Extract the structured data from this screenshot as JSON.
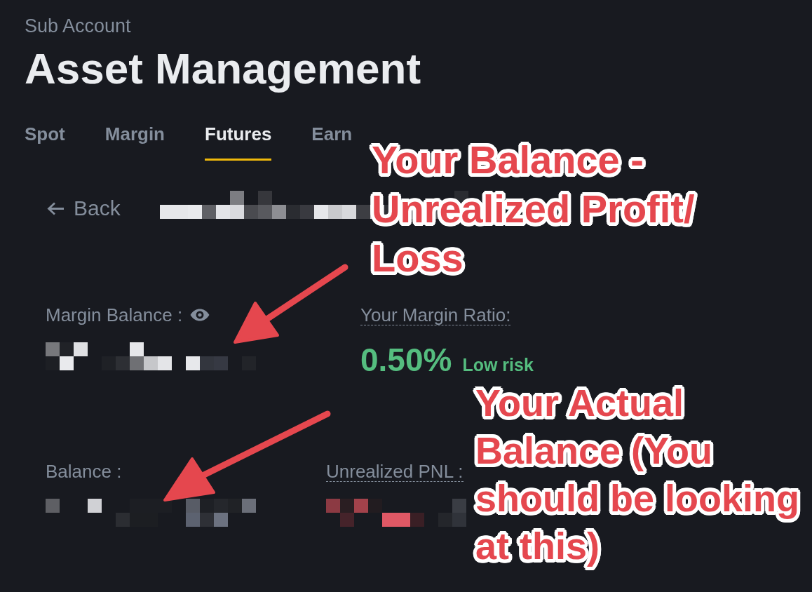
{
  "header": {
    "breadcrumb": "Sub Account",
    "title": "Asset Management"
  },
  "tabs": [
    {
      "label": "Spot",
      "selected": false
    },
    {
      "label": "Margin",
      "selected": false
    },
    {
      "label": "Futures",
      "selected": true
    },
    {
      "label": "Earn",
      "selected": false
    }
  ],
  "back": {
    "label": "Back"
  },
  "stat_rows": [
    {
      "stats": [
        {
          "kind": "redacted",
          "label": "Margin Balance :",
          "underlined": false,
          "has_eye": true
        },
        {
          "kind": "ratio",
          "label": "Your Margin Ratio:",
          "underlined": true,
          "has_eye": false,
          "value": "0.50%",
          "risk": "Low risk",
          "low_risk": true
        }
      ]
    },
    {
      "stats": [
        {
          "kind": "redacted",
          "label": "Balance :",
          "underlined": false,
          "has_eye": false
        },
        {
          "kind": "redacted",
          "label": "Unrealized PNL :",
          "underlined": true,
          "has_eye": false
        }
      ]
    }
  ],
  "annotations": [
    {
      "text": "Your Balance - Unrealized Profit/ Loss"
    },
    {
      "text": "Your Actual Balance (You should be looking at this)"
    }
  ]
}
